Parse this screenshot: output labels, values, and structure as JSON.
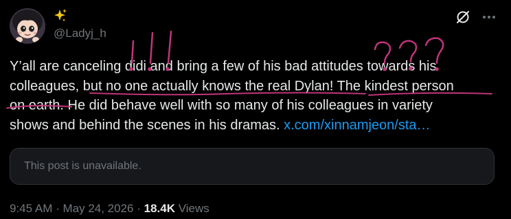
{
  "author": {
    "display_name_emoji": "✨",
    "handle": "@Ladyj_h"
  },
  "post": {
    "lines": [
      {
        "text": "Y’all are canceling didi and bring a few of his bad attitudes towards his"
      },
      {
        "text": "colleagues, but no one actually knows the real Dylan! The kindest person"
      },
      {
        "text": "on earth. He did behave well with so many of his colleagues in variety"
      },
      {
        "text_before_link": "shows and behind the scenes in his dramas. ",
        "link": "x.com/xinnamjeon/sta…"
      }
    ]
  },
  "annotations": {
    "exclamations": "!!!",
    "questions": "???",
    "color": "#c0357a"
  },
  "quoted_post": {
    "message": "This post is unavailable."
  },
  "meta": {
    "time": "9:45 AM",
    "separator": " · ",
    "date": "May 24, 2026",
    "views_count": "18.4K",
    "views_label": " Views"
  },
  "colors": {
    "background": "#000000",
    "text": "#e7e9ea",
    "secondary_text": "#71767b",
    "link": "#1d9bf0",
    "card_border": "#2f3336"
  }
}
